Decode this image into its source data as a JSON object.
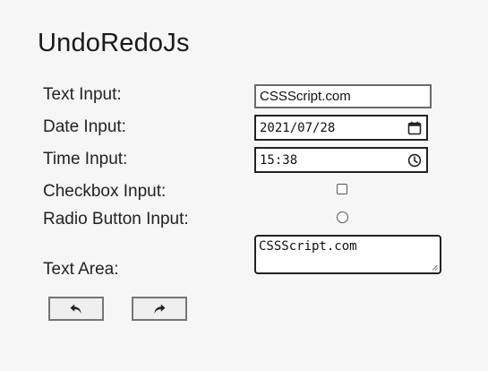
{
  "app": {
    "title": "UndoRedoJs"
  },
  "form": {
    "text_input": {
      "label": "Text Input:",
      "value": "CSSScript.com"
    },
    "date_input": {
      "label": "Date Input:",
      "value": "2021/07/28",
      "icon": "calendar-icon"
    },
    "time_input": {
      "label": "Time Input:",
      "value": "15:38",
      "icon": "clock-icon"
    },
    "checkbox_input": {
      "label": "Checkbox Input:",
      "checked": false
    },
    "radio_input": {
      "label": "Radio Button Input:",
      "checked": false
    },
    "text_area": {
      "label": "Text Area:",
      "value": "CSSScript.com"
    }
  },
  "toolbar": {
    "undo_icon": "undo-icon",
    "redo_icon": "redo-icon"
  }
}
